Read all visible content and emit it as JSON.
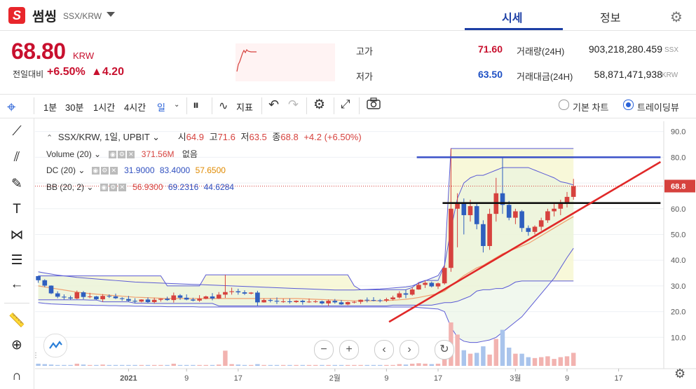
{
  "header": {
    "logo_glyph": "S",
    "coin_name": "썸씽",
    "pair": "SSX/KRW",
    "tabs": [
      {
        "label": "시세"
      },
      {
        "label": "정보"
      }
    ]
  },
  "ticker": {
    "price": "68.80",
    "unit": "KRW",
    "change_label": "전일대비",
    "change_pct": "+6.50%",
    "change_abs": "▲4.20",
    "high_label": "고가",
    "high": "71.60",
    "low_label": "저가",
    "low": "63.50",
    "volume_label": "거래량(24H)",
    "volume": "903,218,280.459",
    "volume_unit": "SSX",
    "amount_label": "거래대금(24H)",
    "amount": "58,871,471,938",
    "amount_unit": "KRW"
  },
  "toolbar": {
    "timeframes": [
      "1분",
      "30분",
      "1시간",
      "4시간",
      "일"
    ],
    "indicator_label": "지표",
    "basic_chart_label": "기본 차트",
    "trading_view_label": "트레이딩뷰"
  },
  "legend": {
    "main": {
      "symbol": "SSX/KRW, 1일, UPBIT",
      "o_label": "시",
      "o": "64.9",
      "h_label": "고",
      "h": "71.6",
      "l_label": "저",
      "l": "63.5",
      "c_label": "종",
      "c": "68.8",
      "chg": "+4.2 (+6.50%)"
    },
    "volume": {
      "name": "Volume (20)",
      "value": "371.56M",
      "extra": "없음"
    },
    "dc": {
      "name": "DC (20)",
      "v1": "31.9000",
      "v2": "83.4000",
      "v3": "57.6500"
    },
    "bb": {
      "name": "BB (20, 2)",
      "v1": "56.9300",
      "v2": "69.2316",
      "v3": "44.6284"
    }
  },
  "colors": {
    "up": "#d6423e",
    "down": "#2f5fbf",
    "accent": "#1d3fa5",
    "band": "#5b5bd6"
  },
  "chart_data": {
    "type": "candlestick",
    "current_price_label": "68.8",
    "y_ticks": [
      "90.0",
      "80.0",
      "70.0",
      "60.0",
      "50.0",
      "40.0",
      "30.0",
      "20.0",
      "10.0"
    ],
    "y_tick_values": [
      90,
      80,
      70,
      60,
      50,
      40,
      30,
      20,
      10
    ],
    "ylim": [
      0,
      94
    ],
    "x_ticks": [
      {
        "label": "2021",
        "i": 14
      },
      {
        "label": "9",
        "i": 23
      },
      {
        "label": "17",
        "i": 31
      },
      {
        "label": "2월",
        "i": 46
      },
      {
        "label": "9",
        "i": 54
      },
      {
        "label": "17",
        "i": 62
      },
      {
        "label": "3월",
        "i": 74
      },
      {
        "label": "9",
        "i": 82
      },
      {
        "label": "17",
        "i": 90
      }
    ],
    "candles_ohlc": [
      [
        33.8,
        33.9,
        31.2,
        32.2
      ],
      [
        32.2,
        32.6,
        29.5,
        30.1
      ],
      [
        30.1,
        30.2,
        26.8,
        27.1
      ],
      [
        27.1,
        27.9,
        25.2,
        25.8
      ],
      [
        25.8,
        26.7,
        24.7,
        25.5
      ],
      [
        25.5,
        26.2,
        24.6,
        25.1
      ],
      [
        25.1,
        28.2,
        24.8,
        27.5
      ],
      [
        27.5,
        28.0,
        24.8,
        25.7
      ],
      [
        25.7,
        27.3,
        25.2,
        25.9
      ],
      [
        25.9,
        26.1,
        24.5,
        24.8
      ],
      [
        24.8,
        26.8,
        23.8,
        26.1
      ],
      [
        26.1,
        26.7,
        25.3,
        25.9
      ],
      [
        25.9,
        27.0,
        24.9,
        25.2
      ],
      [
        25.2,
        25.6,
        24.2,
        24.9
      ],
      [
        24.9,
        26.1,
        23.9,
        24.2
      ],
      [
        24.2,
        25.2,
        23.3,
        23.9
      ],
      [
        23.9,
        24.8,
        23.6,
        24.7
      ],
      [
        24.7,
        25.5,
        23.3,
        23.7
      ],
      [
        23.7,
        25.4,
        23.2,
        24.6
      ],
      [
        24.6,
        25.1,
        23.9,
        25.0
      ],
      [
        25.0,
        25.8,
        24.2,
        24.5
      ],
      [
        24.5,
        27.4,
        23.5,
        26.3
      ],
      [
        26.3,
        26.8,
        24.6,
        25.4
      ],
      [
        25.4,
        26.7,
        24.4,
        24.7
      ],
      [
        24.7,
        25.4,
        24.0,
        24.3
      ],
      [
        24.3,
        26.4,
        23.8,
        25.0
      ],
      [
        25.0,
        26.2,
        24.8,
        25.9
      ],
      [
        25.9,
        27.2,
        24.4,
        25.1
      ],
      [
        25.1,
        27.6,
        24.9,
        26.6
      ],
      [
        26.6,
        34.3,
        25.3,
        27.6
      ],
      [
        27.6,
        29.3,
        26.6,
        27.9
      ],
      [
        27.9,
        28.9,
        26.6,
        27.5
      ],
      [
        27.5,
        28.3,
        26.5,
        27.0
      ],
      [
        27.0,
        27.6,
        26.7,
        27.4
      ],
      [
        27.4,
        28.1,
        22.2,
        23.6
      ],
      [
        23.6,
        25.1,
        23.5,
        24.5
      ],
      [
        24.5,
        25.1,
        23.6,
        24.2
      ],
      [
        24.2,
        25.5,
        23.0,
        23.9
      ],
      [
        23.9,
        25.0,
        23.4,
        24.0
      ],
      [
        24.0,
        25.1,
        23.1,
        23.7
      ],
      [
        23.7,
        24.4,
        23.4,
        24.2
      ],
      [
        24.2,
        24.6,
        22.7,
        23.7
      ],
      [
        23.7,
        25.1,
        23.4,
        23.9
      ],
      [
        23.9,
        24.5,
        23.4,
        24.0
      ],
      [
        24.0,
        24.3,
        22.8,
        23.2
      ],
      [
        23.2,
        24.7,
        22.2,
        24.2
      ],
      [
        24.2,
        24.9,
        23.1,
        23.6
      ],
      [
        23.6,
        24.5,
        22.6,
        22.8
      ],
      [
        22.8,
        23.9,
        22.5,
        23.7
      ],
      [
        23.7,
        24.1,
        23.2,
        23.8
      ],
      [
        23.8,
        24.7,
        23.0,
        24.6
      ],
      [
        24.6,
        25.5,
        23.6,
        24.5
      ],
      [
        24.5,
        25.6,
        24.0,
        24.4
      ],
      [
        24.4,
        24.9,
        23.6,
        24.3
      ],
      [
        24.3,
        25.4,
        23.7,
        24.8
      ],
      [
        24.8,
        26.2,
        24.3,
        25.5
      ],
      [
        25.5,
        27.9,
        25.1,
        27.1
      ],
      [
        27.1,
        28.6,
        25.2,
        26.6
      ],
      [
        26.6,
        29.4,
        26.2,
        28.6
      ],
      [
        28.6,
        31.3,
        28.5,
        30.4
      ],
      [
        30.4,
        32.1,
        29.2,
        31.2
      ],
      [
        31.2,
        31.7,
        29.4,
        29.8
      ],
      [
        29.8,
        31.3,
        28.8,
        31.0
      ],
      [
        31.0,
        38.0,
        30.5,
        37.0
      ],
      [
        37.0,
        83.4,
        35.5,
        60.0
      ],
      [
        60.0,
        66.0,
        45.0,
        62.5
      ],
      [
        62.5,
        64.0,
        50.0,
        57.5
      ],
      [
        57.5,
        63.5,
        55.0,
        61.0
      ],
      [
        61.0,
        62.0,
        52.0,
        54.0
      ],
      [
        54.0,
        55.5,
        43.0,
        45.5
      ],
      [
        45.5,
        60.0,
        44.0,
        58.0
      ],
      [
        58.0,
        72.0,
        55.0,
        66.0
      ],
      [
        66.0,
        80.0,
        58.0,
        61.5
      ],
      [
        61.5,
        63.0,
        55.5,
        56.5
      ],
      [
        56.5,
        60.0,
        54.0,
        59.0
      ],
      [
        59.0,
        59.5,
        51.0,
        52.5
      ],
      [
        52.5,
        53.5,
        49.5,
        51.0
      ],
      [
        51.0,
        53.5,
        50.0,
        53.0
      ],
      [
        53.0,
        56.5,
        51.5,
        55.5
      ],
      [
        55.5,
        60.0,
        54.5,
        59.0
      ],
      [
        59.0,
        62.5,
        57.0,
        60.0
      ],
      [
        60.0,
        63.5,
        57.5,
        62.5
      ],
      [
        62.5,
        66.5,
        60.5,
        64.6
      ],
      [
        64.6,
        71.6,
        63.5,
        68.8
      ]
    ],
    "bb_upper": [
      35.5,
      35,
      34.6,
      34.2,
      33.9,
      33.6,
      33.3,
      33.1,
      32.9,
      32.7,
      32.5,
      32.3,
      32.1,
      31.9,
      31.7,
      31.5,
      31.4,
      31.3,
      31.2,
      31.1,
      31,
      30.9,
      30.8,
      30.7,
      30.6,
      30.5,
      30.4,
      30.3,
      30.2,
      30.1,
      30,
      29.9,
      29.8,
      29.7,
      29.6,
      29.5,
      29.4,
      29.3,
      29.2,
      29.1,
      29,
      28.9,
      28.8,
      28.7,
      28.6,
      28.5,
      28.4,
      28.4,
      28.4,
      28.4,
      28.5,
      28.6,
      28.7,
      28.8,
      29,
      29.2,
      29.4,
      29.6,
      30,
      31,
      32,
      33,
      34,
      38,
      52,
      64,
      70,
      72,
      73,
      73,
      74,
      75,
      76,
      76,
      76,
      76,
      76,
      75,
      74,
      73,
      72,
      70.5,
      70,
      69.23
    ],
    "bb_lower": [
      23.5,
      23.2,
      23,
      22.9,
      22.8,
      22.7,
      22.6,
      22.5,
      22.5,
      22.4,
      22.4,
      22.3,
      22.3,
      22.2,
      22.2,
      22.1,
      22.1,
      22,
      22,
      22,
      21.9,
      21.9,
      21.9,
      21.9,
      21.9,
      21.8,
      21.8,
      21.8,
      21.8,
      21.8,
      21.8,
      21.8,
      21.8,
      21.8,
      21.8,
      21.8,
      21.8,
      21.8,
      21.8,
      21.8,
      21.8,
      21.8,
      21.8,
      21.8,
      21.8,
      21.8,
      21.8,
      21.8,
      21.8,
      21.8,
      21.8,
      21.8,
      21.8,
      21.8,
      21.8,
      21.8,
      21.8,
      21.8,
      21.8,
      21.6,
      21.4,
      21.2,
      21,
      20,
      14,
      10,
      8.5,
      8,
      8,
      8.5,
      9,
      10,
      12,
      14,
      16,
      18,
      21,
      24,
      27,
      30,
      33,
      37,
      41,
      44.63
    ],
    "dc_upper": [
      33.9,
      33.9,
      33.9,
      33.9,
      33.9,
      33.9,
      33.9,
      33.9,
      33.9,
      33.9,
      33.9,
      33.9,
      33.9,
      33.9,
      33.9,
      33.9,
      33.9,
      33.9,
      33.9,
      33.9,
      30.0,
      30.0,
      30.0,
      30.0,
      30.0,
      30.0,
      34.3,
      34.3,
      34.3,
      34.3,
      34.3,
      34.3,
      34.3,
      34.3,
      34.3,
      34.3,
      34.3,
      34.3,
      34.3,
      34.3,
      34.3,
      34.3,
      34.3,
      34.3,
      34.3,
      34.3,
      34.3,
      34.3,
      34.3,
      30.0,
      28.5,
      28.5,
      28.5,
      28.5,
      28.5,
      28.5,
      28.5,
      28.5,
      29.4,
      31.3,
      32.1,
      32.1,
      32.1,
      38.0,
      83.4,
      83.4,
      83.4,
      83.4,
      83.4,
      83.4,
      83.4,
      83.4,
      83.4,
      83.4,
      83.4,
      83.4,
      83.4,
      83.4,
      83.4,
      83.4,
      83.4,
      83.4,
      83.4,
      83.4
    ],
    "dc_lower": [
      24.6,
      24.6,
      24.6,
      24.6,
      24.6,
      24.6,
      24.6,
      24.6,
      24.5,
      24.5,
      23.8,
      23.8,
      23.8,
      23.8,
      23.8,
      23.3,
      23.3,
      23.3,
      23.2,
      23.2,
      23.2,
      23.2,
      23.2,
      23.2,
      23.2,
      23.2,
      23.2,
      23.2,
      22.2,
      22.2,
      22.2,
      22.2,
      22.2,
      22.2,
      22.2,
      22.2,
      22.2,
      22.2,
      22.2,
      22.2,
      22.2,
      22.2,
      22.2,
      22.2,
      22.2,
      22.2,
      22.2,
      22.2,
      22.2,
      22.2,
      22.2,
      22.2,
      22.2,
      22.2,
      22.2,
      22.5,
      22.5,
      22.5,
      22.5,
      22.5,
      22.5,
      22.5,
      23.0,
      23.5,
      23.5,
      24.0,
      25.0,
      26.0,
      28.0,
      28.5,
      28.5,
      29.0,
      29.0,
      30.0,
      31.5,
      31.9,
      31.9,
      31.9,
      31.9,
      31.9,
      31.9,
      31.9,
      31.9,
      31.9
    ],
    "ma": [
      30,
      29.6,
      29.2,
      28.8,
      28.4,
      28,
      27.6,
      27.3,
      27,
      26.8,
      26.6,
      26.4,
      26.2,
      26,
      25.8,
      25.6,
      25.5,
      25.4,
      25.3,
      25.2,
      25.1,
      25.1,
      25.1,
      25.1,
      25.1,
      25.1,
      25.1,
      25.1,
      25.1,
      25.1,
      25.1,
      25.1,
      25.1,
      25.1,
      25.1,
      25.1,
      25.1,
      25.1,
      25.1,
      25.1,
      25.1,
      25,
      24.9,
      24.8,
      24.7,
      24.6,
      24.5,
      24.4,
      24.3,
      24.2,
      24.2,
      24.2,
      24.2,
      24.2,
      24.3,
      24.4,
      24.6,
      24.8,
      25.1,
      25.5,
      26,
      26.5,
      27,
      28,
      30,
      32,
      34,
      35.5,
      37,
      38,
      39.5,
      41,
      42.5,
      43.5,
      44.5,
      45.5,
      46.5,
      48,
      49.5,
      51,
      52.5,
      54,
      55.5,
      56.93
    ],
    "volume": [
      0.05,
      0.04,
      0.03,
      0.02,
      0.02,
      0.02,
      0.05,
      0.03,
      0.02,
      0.02,
      0.03,
      0.02,
      0.02,
      0.02,
      0.02,
      0.02,
      0.02,
      0.02,
      0.02,
      0.02,
      0.02,
      0.05,
      0.02,
      0.02,
      0.02,
      0.02,
      0.02,
      0.02,
      0.03,
      0.35,
      0.04,
      0.03,
      0.02,
      0.02,
      0.04,
      0.02,
      0.02,
      0.02,
      0.02,
      0.02,
      0.02,
      0.02,
      0.02,
      0.02,
      0.02,
      0.02,
      0.02,
      0.02,
      0.02,
      0.02,
      0.02,
      0.02,
      0.02,
      0.02,
      0.02,
      0.02,
      0.04,
      0.03,
      0.05,
      0.06,
      0.05,
      0.04,
      0.05,
      0.2,
      1.0,
      0.72,
      0.36,
      0.28,
      0.3,
      0.45,
      0.26,
      0.62,
      0.83,
      0.42,
      0.28,
      0.28,
      0.2,
      0.18,
      0.2,
      0.22,
      0.16,
      0.2,
      0.22,
      0.3
    ],
    "trendlines": [
      {
        "color": "#3a50c8",
        "from": [
          58.7,
          80.0
        ],
        "to": [
          96.5,
          80.0
        ]
      },
      {
        "color": "#111111",
        "from": [
          62.7,
          62.2
        ],
        "to": [
          96.5,
          62.2
        ]
      },
      {
        "color": "#e02828",
        "from": [
          54.4,
          16.0
        ],
        "to": [
          96.5,
          78.2
        ]
      }
    ]
  }
}
